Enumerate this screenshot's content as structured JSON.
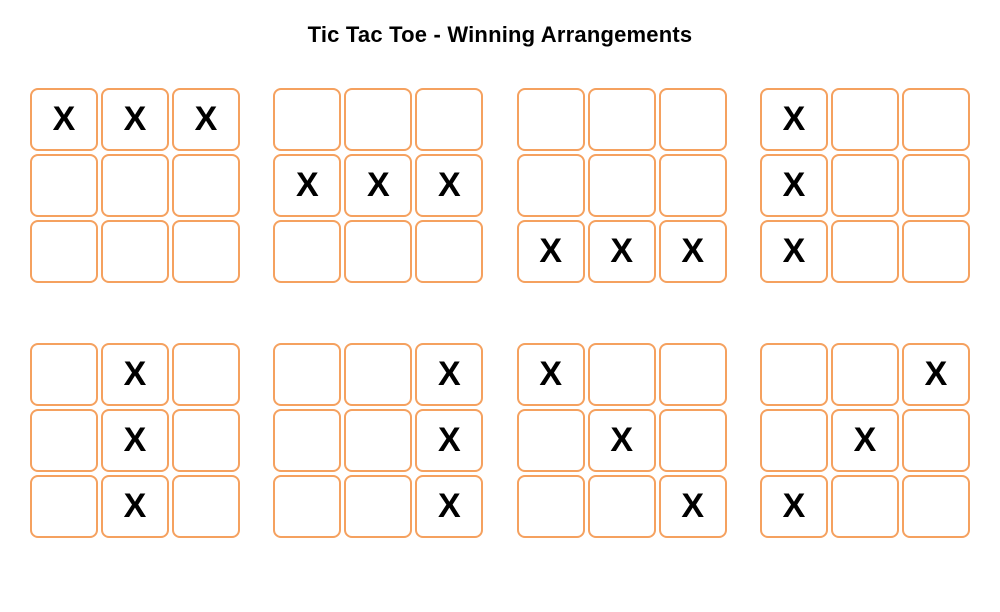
{
  "title": "Tic Tac Toe - Winning Arrangements",
  "mark": "X",
  "boards": [
    [
      [
        1,
        1,
        1
      ],
      [
        0,
        0,
        0
      ],
      [
        0,
        0,
        0
      ]
    ],
    [
      [
        0,
        0,
        0
      ],
      [
        1,
        1,
        1
      ],
      [
        0,
        0,
        0
      ]
    ],
    [
      [
        0,
        0,
        0
      ],
      [
        0,
        0,
        0
      ],
      [
        1,
        1,
        1
      ]
    ],
    [
      [
        1,
        0,
        0
      ],
      [
        1,
        0,
        0
      ],
      [
        1,
        0,
        0
      ]
    ],
    [
      [
        0,
        1,
        0
      ],
      [
        0,
        1,
        0
      ],
      [
        0,
        1,
        0
      ]
    ],
    [
      [
        0,
        0,
        1
      ],
      [
        0,
        0,
        1
      ],
      [
        0,
        0,
        1
      ]
    ],
    [
      [
        1,
        0,
        0
      ],
      [
        0,
        1,
        0
      ],
      [
        0,
        0,
        1
      ]
    ],
    [
      [
        0,
        0,
        1
      ],
      [
        0,
        1,
        0
      ],
      [
        1,
        0,
        0
      ]
    ]
  ]
}
